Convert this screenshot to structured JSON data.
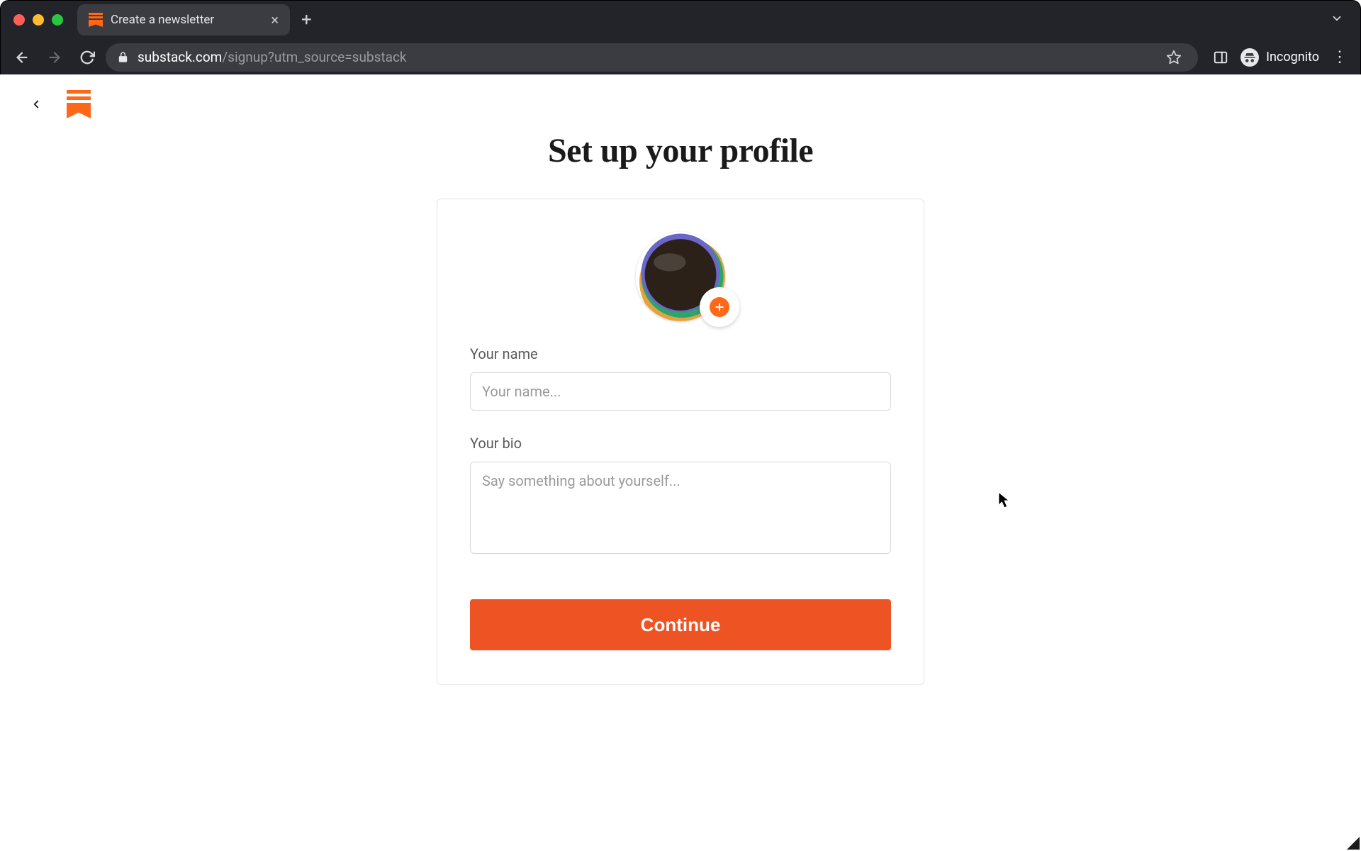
{
  "browser": {
    "tab_title": "Create a newsletter",
    "url_host": "substack.com",
    "url_rest": "/signup?utm_source=substack",
    "incognito_label": "Incognito"
  },
  "page": {
    "heading": "Set up your profile",
    "name_label": "Your name",
    "name_placeholder": "Your name...",
    "bio_label": "Your bio",
    "bio_placeholder": "Say something about yourself...",
    "continue_label": "Continue"
  }
}
